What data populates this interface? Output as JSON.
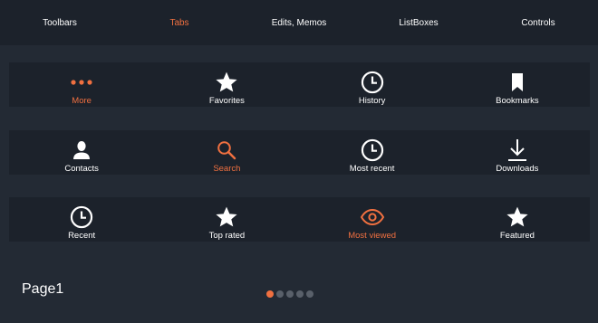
{
  "top_tabs": [
    {
      "label": "Toolbars",
      "active": false
    },
    {
      "label": "Tabs",
      "active": true
    },
    {
      "label": "Edits, Memos",
      "active": false
    },
    {
      "label": "ListBoxes",
      "active": false
    },
    {
      "label": "Controls",
      "active": false
    }
  ],
  "tabbars": [
    {
      "items": [
        {
          "label": "More",
          "icon": "more-icon",
          "active": true
        },
        {
          "label": "Favorites",
          "icon": "star-icon",
          "active": false
        },
        {
          "label": "History",
          "icon": "clock-icon",
          "active": false
        },
        {
          "label": "Bookmarks",
          "icon": "bookmark-icon",
          "active": false
        }
      ]
    },
    {
      "items": [
        {
          "label": "Contacts",
          "icon": "person-icon",
          "active": false
        },
        {
          "label": "Search",
          "icon": "search-icon",
          "active": true
        },
        {
          "label": "Most recent",
          "icon": "clock-icon",
          "active": false
        },
        {
          "label": "Downloads",
          "icon": "download-icon",
          "active": false
        }
      ]
    },
    {
      "items": [
        {
          "label": "Recent",
          "icon": "clock-icon",
          "active": false
        },
        {
          "label": "Top rated",
          "icon": "star-icon",
          "active": false
        },
        {
          "label": "Most viewed",
          "icon": "eye-icon",
          "active": true
        },
        {
          "label": "Featured",
          "icon": "star-icon",
          "active": false
        }
      ]
    }
  ],
  "pager": {
    "page_label": "Page1",
    "page_count": 5,
    "current_page": 1
  },
  "colors": {
    "accent": "#f07040",
    "background": "#232a34",
    "bar": "#1c222b",
    "text": "#ffffff",
    "inactive_dot": "#59606a"
  }
}
